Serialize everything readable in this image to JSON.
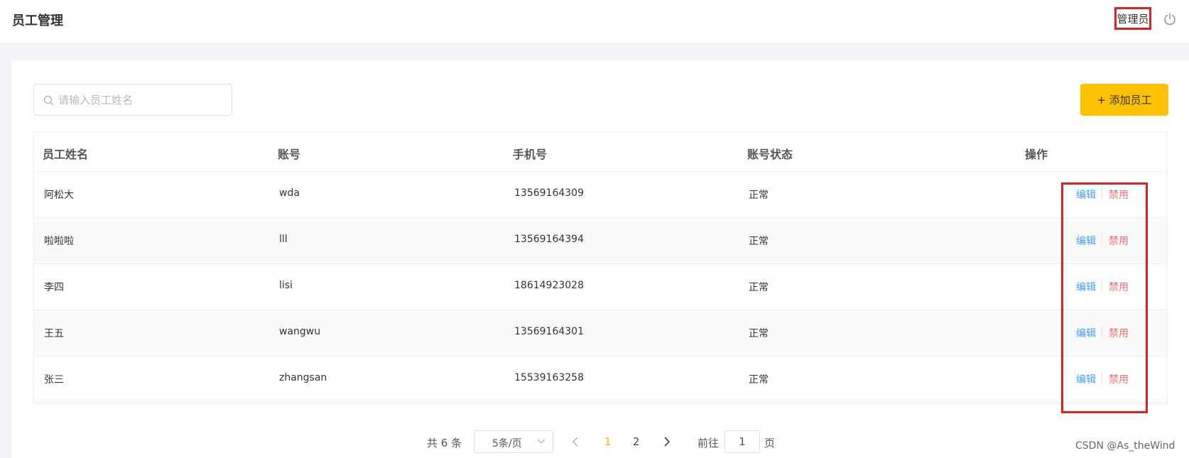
{
  "header": {
    "title": "员工管理",
    "user_label": "管理员",
    "logout_icon": "power-icon"
  },
  "search": {
    "placeholder": "请输入员工姓名",
    "value": "",
    "icon": "search-icon"
  },
  "add_button": {
    "label": "+ 添加员工"
  },
  "table": {
    "columns": [
      "员工姓名",
      "账号",
      "手机号",
      "账号状态",
      "操作"
    ],
    "rows": [
      {
        "name": "阿松大",
        "account": "wda",
        "phone": "13569164309",
        "status": "正常"
      },
      {
        "name": "啦啦啦",
        "account": "lll",
        "phone": "13569164394",
        "status": "正常"
      },
      {
        "name": "李四",
        "account": "lisi",
        "phone": "18614923028",
        "status": "正常"
      },
      {
        "name": "王五",
        "account": "wangwu",
        "phone": "13569164301",
        "status": "正常"
      },
      {
        "name": "张三",
        "account": "zhangsan",
        "phone": "15539163258",
        "status": "正常"
      }
    ],
    "actions": {
      "edit": "编辑",
      "disable": "禁用"
    }
  },
  "pagination": {
    "total_text": "共 6 条",
    "page_size": "5条/页",
    "pages": [
      "1",
      "2"
    ],
    "current_page": "1",
    "goto_label": "前往",
    "goto_value": "1",
    "page_suffix": "页"
  },
  "watermark": "CSDN @As_theWind",
  "colors": {
    "accent": "#ffc200",
    "link_blue": "#409eff",
    "danger_red": "#f56c6c",
    "active_page": "#ffb300",
    "annotation_red": "#e02020"
  }
}
